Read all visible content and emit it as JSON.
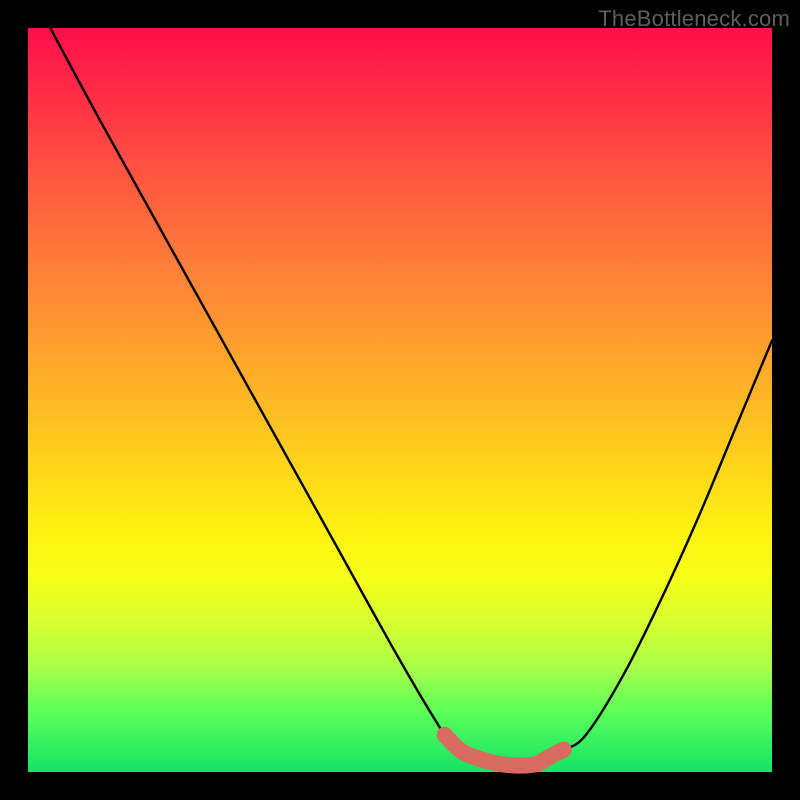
{
  "watermark": "TheBottleneck.com",
  "chart_data": {
    "type": "line",
    "title": "",
    "xlabel": "",
    "ylabel": "",
    "xlim": [
      0,
      100
    ],
    "ylim": [
      0,
      100
    ],
    "grid": false,
    "legend": false,
    "series": [
      {
        "name": "bottleneck-curve",
        "x": [
          3,
          10,
          20,
          30,
          40,
          50,
          56,
          58,
          60,
          64,
          68,
          70,
          72,
          75,
          80,
          85,
          90,
          95,
          100
        ],
        "y": [
          100,
          87,
          69,
          51,
          33,
          15,
          5,
          3,
          2,
          1,
          1,
          2,
          3,
          5,
          13,
          23,
          34,
          46,
          58
        ]
      }
    ],
    "highlight_segment": {
      "name": "minimum-plateau",
      "x": [
        56,
        58,
        60,
        64,
        68,
        70,
        72
      ],
      "y": [
        5,
        3,
        2,
        1,
        1,
        2,
        3
      ],
      "color": "#d96a5f"
    },
    "background_gradient_stops": [
      {
        "pos": 0,
        "color": "#ff0f4b"
      },
      {
        "pos": 20,
        "color": "#ff5640"
      },
      {
        "pos": 44,
        "color": "#ffa42c"
      },
      {
        "pos": 68,
        "color": "#fff210"
      },
      {
        "pos": 86,
        "color": "#a8ff4a"
      },
      {
        "pos": 100,
        "color": "#15e365"
      }
    ]
  }
}
